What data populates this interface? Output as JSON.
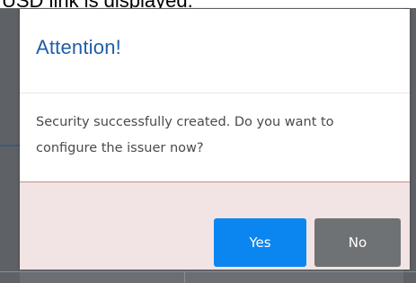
{
  "document": {
    "caption": "USD link is displayed."
  },
  "dialog": {
    "title": "Attention!",
    "message": "Security successfully created. Do you want to configure the issuer now?",
    "buttons": {
      "yes_label": "Yes",
      "no_label": "No"
    }
  },
  "colors": {
    "title": "#1f5ea8",
    "yes_button": "#0b86f0",
    "no_button": "#6f7275",
    "footer_background": "#f2e4e4",
    "footer_border": "#c98b8b",
    "overlay": "#6b6e72"
  }
}
